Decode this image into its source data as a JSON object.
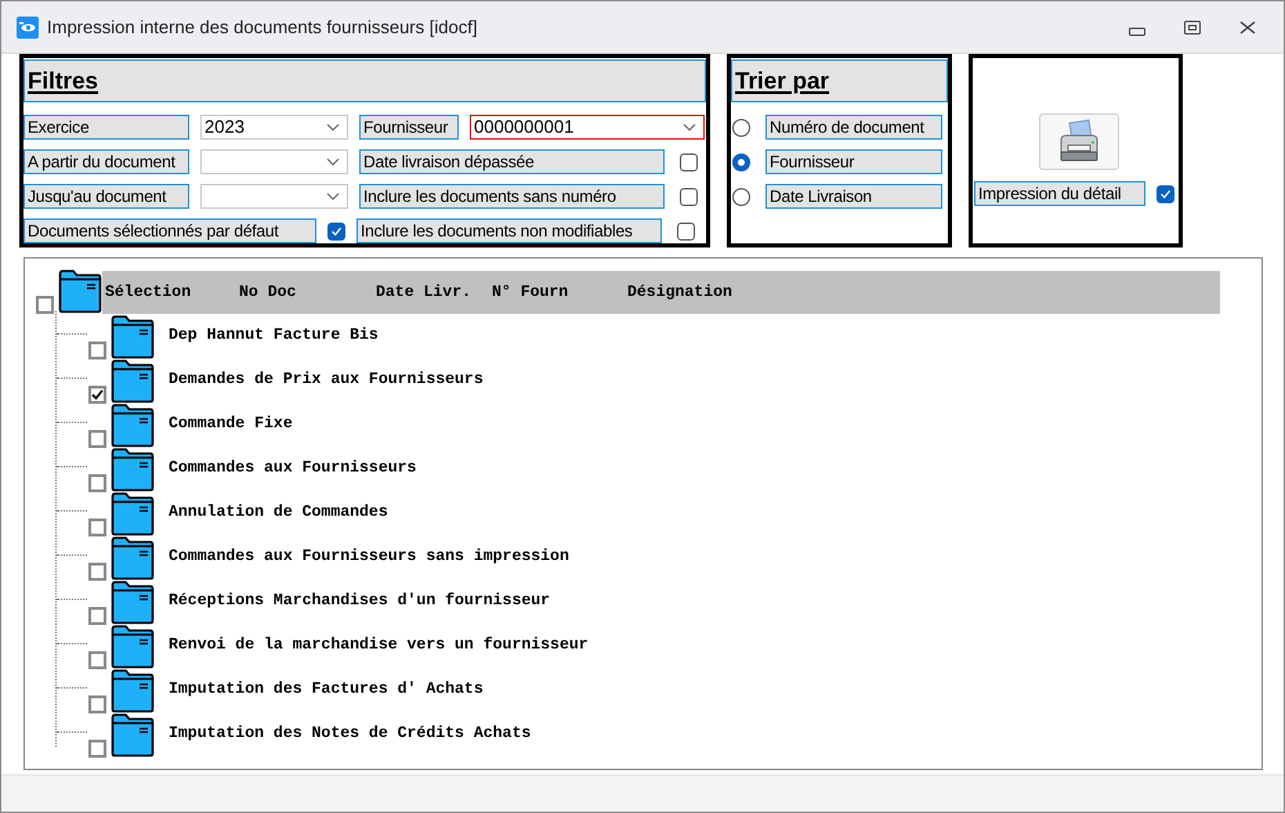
{
  "window": {
    "title": "Impression interne des documents fournisseurs [idocf]"
  },
  "filters": {
    "title": "Filtres",
    "exercice": {
      "label": "Exercice",
      "value": "2023"
    },
    "fournisseur": {
      "label": "Fournisseur",
      "value": "0000000001"
    },
    "from_document": {
      "label": "A partir du document"
    },
    "to_document": {
      "label": "Jusqu'au document"
    },
    "default_selected": {
      "label": "Documents sélectionnés par défaut",
      "checked": true
    },
    "options": [
      {
        "label": "Date livraison dépassée",
        "checked": false
      },
      {
        "label": "Inclure les documents sans numéro",
        "checked": false
      },
      {
        "label": "Inclure les documents non modifiables",
        "checked": false
      }
    ]
  },
  "sort": {
    "title": "Trier par",
    "options": [
      {
        "label": "Numéro de document",
        "selected": false
      },
      {
        "label": "Fournisseur",
        "selected": true
      },
      {
        "label": "Date Livraison",
        "selected": false
      }
    ]
  },
  "print": {
    "detail": {
      "label": "Impression du détail",
      "checked": true
    }
  },
  "tree": {
    "columns": [
      "Sélection",
      "No Doc",
      "Date Livr.",
      "N° Fourn",
      "Désignation"
    ],
    "root": {
      "checked": false,
      "children": [
        {
          "label": "Dep Hannut Facture Bis",
          "checked": false
        },
        {
          "label": "Demandes de Prix aux Fournisseurs",
          "checked": true
        },
        {
          "label": "Commande Fixe",
          "checked": false
        },
        {
          "label": "Commandes aux Fournisseurs",
          "checked": false
        },
        {
          "label": "Annulation de Commandes",
          "checked": false
        },
        {
          "label": "Commandes aux Fournisseurs sans impression",
          "checked": false
        },
        {
          "label": "Réceptions Marchandises d'un fournisseur",
          "checked": false
        },
        {
          "label": "Renvoi de la marchandise vers un fournisseur",
          "checked": false
        },
        {
          "label": "Imputation des Factures d' Achats",
          "checked": false
        },
        {
          "label": "Imputation des Notes de Crédits Achats",
          "checked": false
        }
      ]
    }
  }
}
